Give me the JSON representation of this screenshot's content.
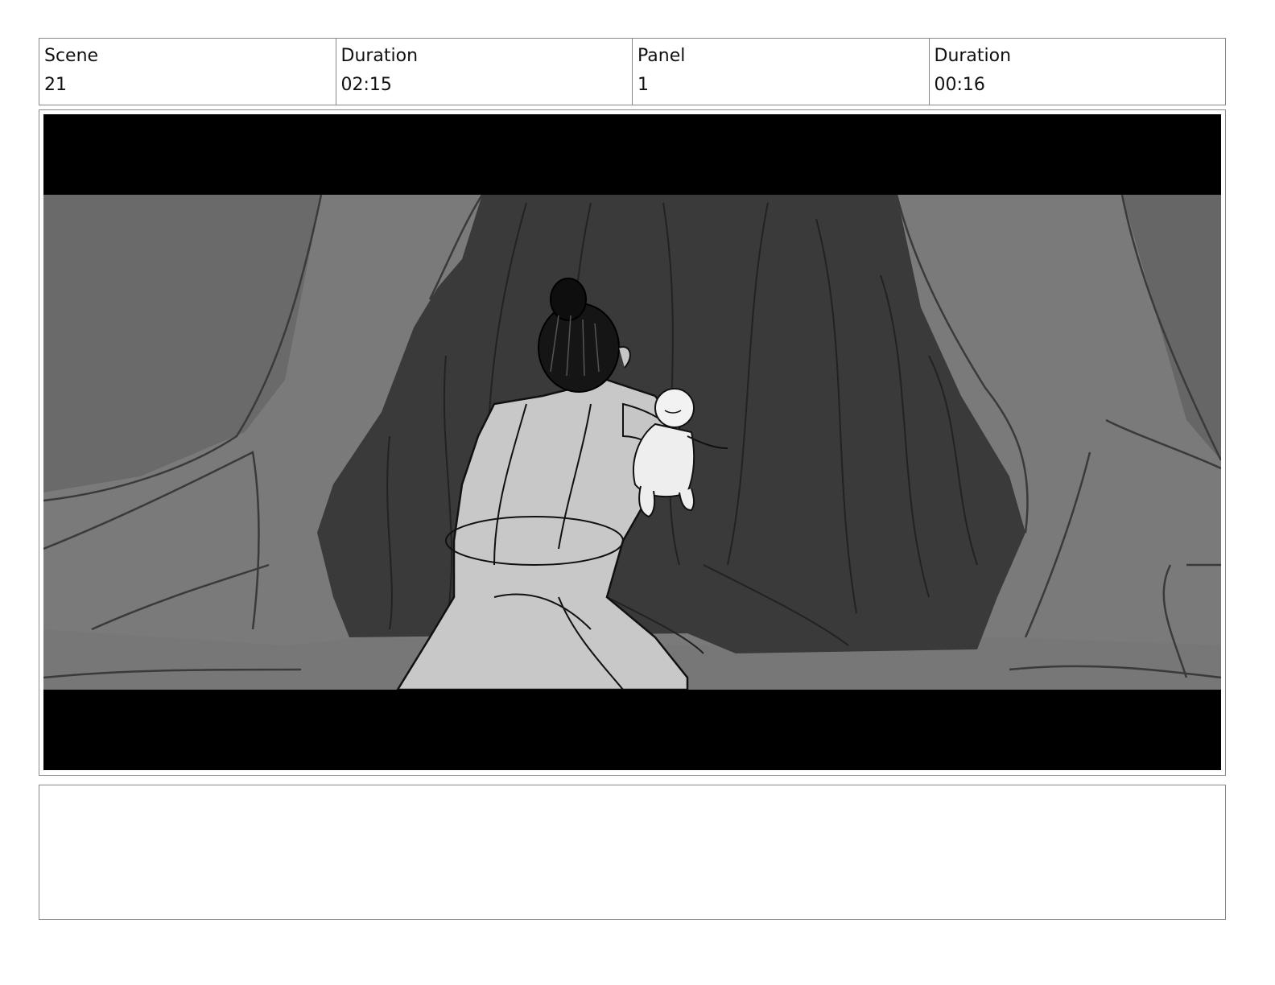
{
  "header": {
    "cells": [
      {
        "label": "Scene",
        "value": "21"
      },
      {
        "label": "Duration",
        "value": "02:15"
      },
      {
        "label": "Panel",
        "value": "1"
      },
      {
        "label": "Duration",
        "value": "00:16"
      }
    ]
  },
  "panel": {
    "letterbox_color": "#000000",
    "cave_interior_color": "#3a3a3a",
    "cave_wall_color": "#7a7a7a",
    "figure_color": "#c8c8c8"
  },
  "notes": {
    "text": ""
  }
}
